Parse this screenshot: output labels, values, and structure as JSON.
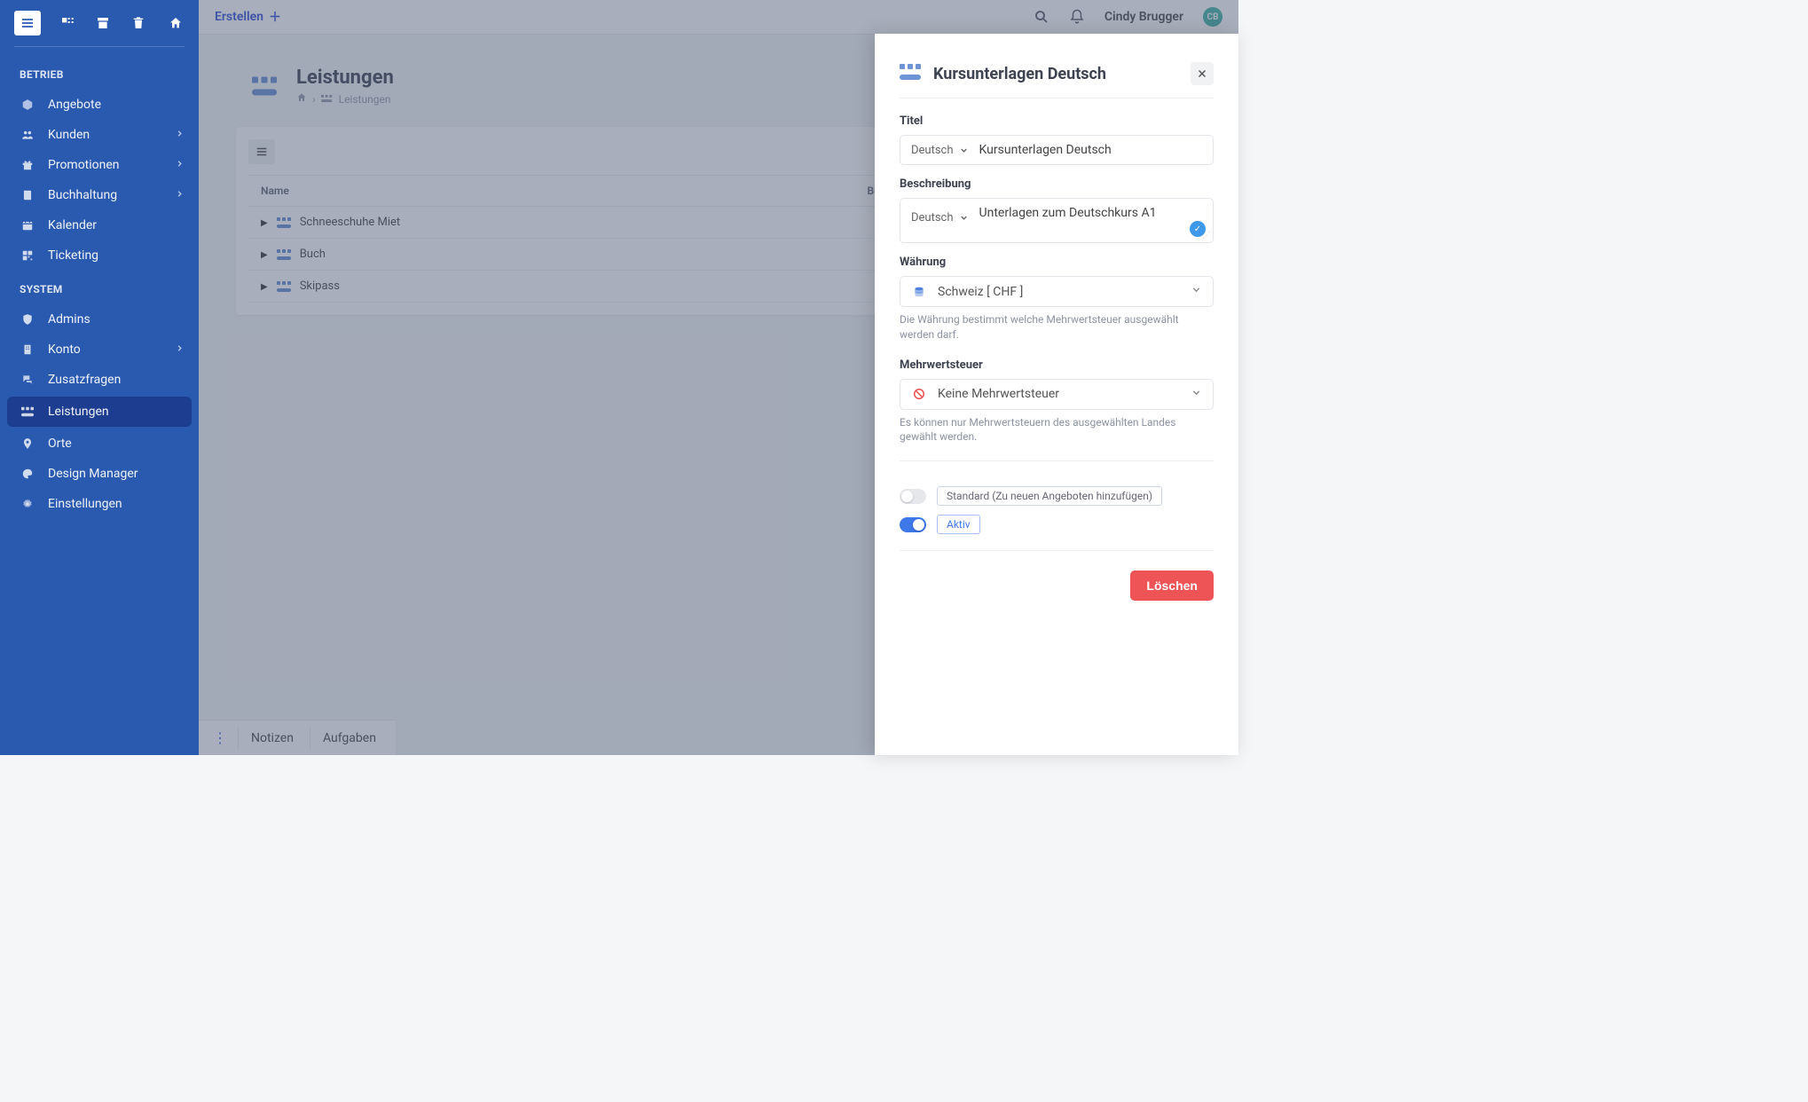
{
  "topbar": {
    "create_label": "Erstellen",
    "user_name": "Cindy Brugger",
    "user_initials": "CB"
  },
  "sidebar": {
    "section1_title": "BETRIEB",
    "section2_title": "SYSTEM",
    "items_betrieb": [
      {
        "label": "Angebote",
        "icon": "cube-icon"
      },
      {
        "label": "Kunden",
        "icon": "users-icon",
        "chevron": true
      },
      {
        "label": "Promotionen",
        "icon": "gift-icon",
        "chevron": true
      },
      {
        "label": "Buchhaltung",
        "icon": "book-icon",
        "chevron": true
      },
      {
        "label": "Kalender",
        "icon": "calendar-icon"
      },
      {
        "label": "Ticketing",
        "icon": "qr-icon"
      }
    ],
    "items_system": [
      {
        "label": "Admins",
        "icon": "shield-icon"
      },
      {
        "label": "Konto",
        "icon": "building-icon",
        "chevron": true
      },
      {
        "label": "Zusatzfragen",
        "icon": "chat-icon"
      },
      {
        "label": "Leistungen",
        "icon": "blocks-icon",
        "active": true
      },
      {
        "label": "Orte",
        "icon": "pin-icon"
      },
      {
        "label": "Design Manager",
        "icon": "palette-icon"
      },
      {
        "label": "Einstellungen",
        "icon": "gear-icon"
      }
    ]
  },
  "page": {
    "title": "Leistungen",
    "breadcrumb_last": "Leistungen",
    "columns": {
      "name": "Name",
      "desc": "Beschreibung"
    },
    "rows": [
      {
        "name": "Schneeschuhe Miet"
      },
      {
        "name": "Buch"
      },
      {
        "name": "Skipass"
      }
    ]
  },
  "bottombar": {
    "tab1": "Notizen",
    "tab2": "Aufgaben"
  },
  "panel": {
    "title": "Kursunterlagen Deutsch",
    "label_title": "Titel",
    "label_desc": "Beschreibung",
    "label_currency": "Währung",
    "label_vat": "Mehrwertsteuer",
    "lang_select": "Deutsch",
    "title_value": "Kursunterlagen Deutsch",
    "desc_value": "Unterlagen zum Deutschkurs A1",
    "currency_value": "Schweiz [ CHF ]",
    "currency_help": "Die Währung bestimmt welche Mehrwertsteuer ausgewählt werden darf.",
    "vat_value": "Keine Mehrwertsteuer",
    "vat_help": "Es können nur Mehrwertsteuern des ausgewählten Landes gewählt werden.",
    "toggle_standard_label": "Standard (Zu neuen Angeboten hinzufügen)",
    "toggle_aktiv_label": "Aktiv",
    "delete_label": "Löschen"
  }
}
